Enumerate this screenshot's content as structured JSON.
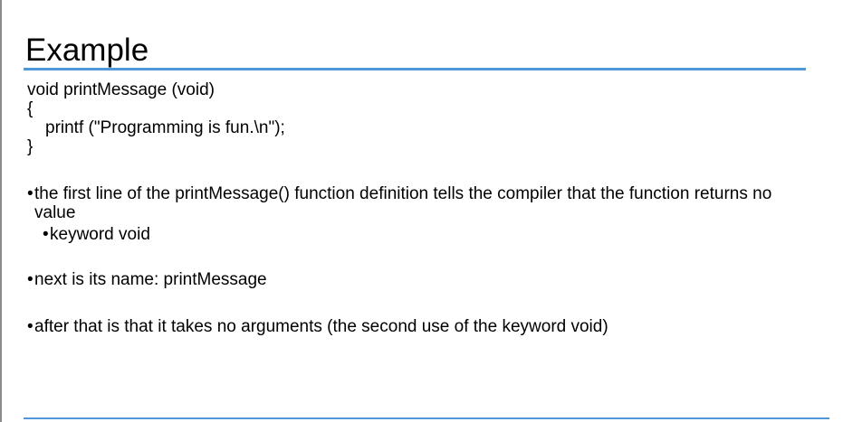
{
  "slide": {
    "title": "Example",
    "code_lines": [
      "void printMessage (void)",
      "{",
      "printf (\"Programming is fun.\\n\");",
      "}"
    ],
    "bullets": [
      "the first line of the printMessage() function definition tells the compiler that the function returns no value",
      "next is its name: printMessage",
      "after that is that it takes no arguments (the second use of the keyword void)"
    ],
    "sub_bullets": [
      "keyword void"
    ],
    "colors": {
      "rule": "#4f97d6",
      "text": "#000000",
      "background": "#ffffff"
    }
  }
}
